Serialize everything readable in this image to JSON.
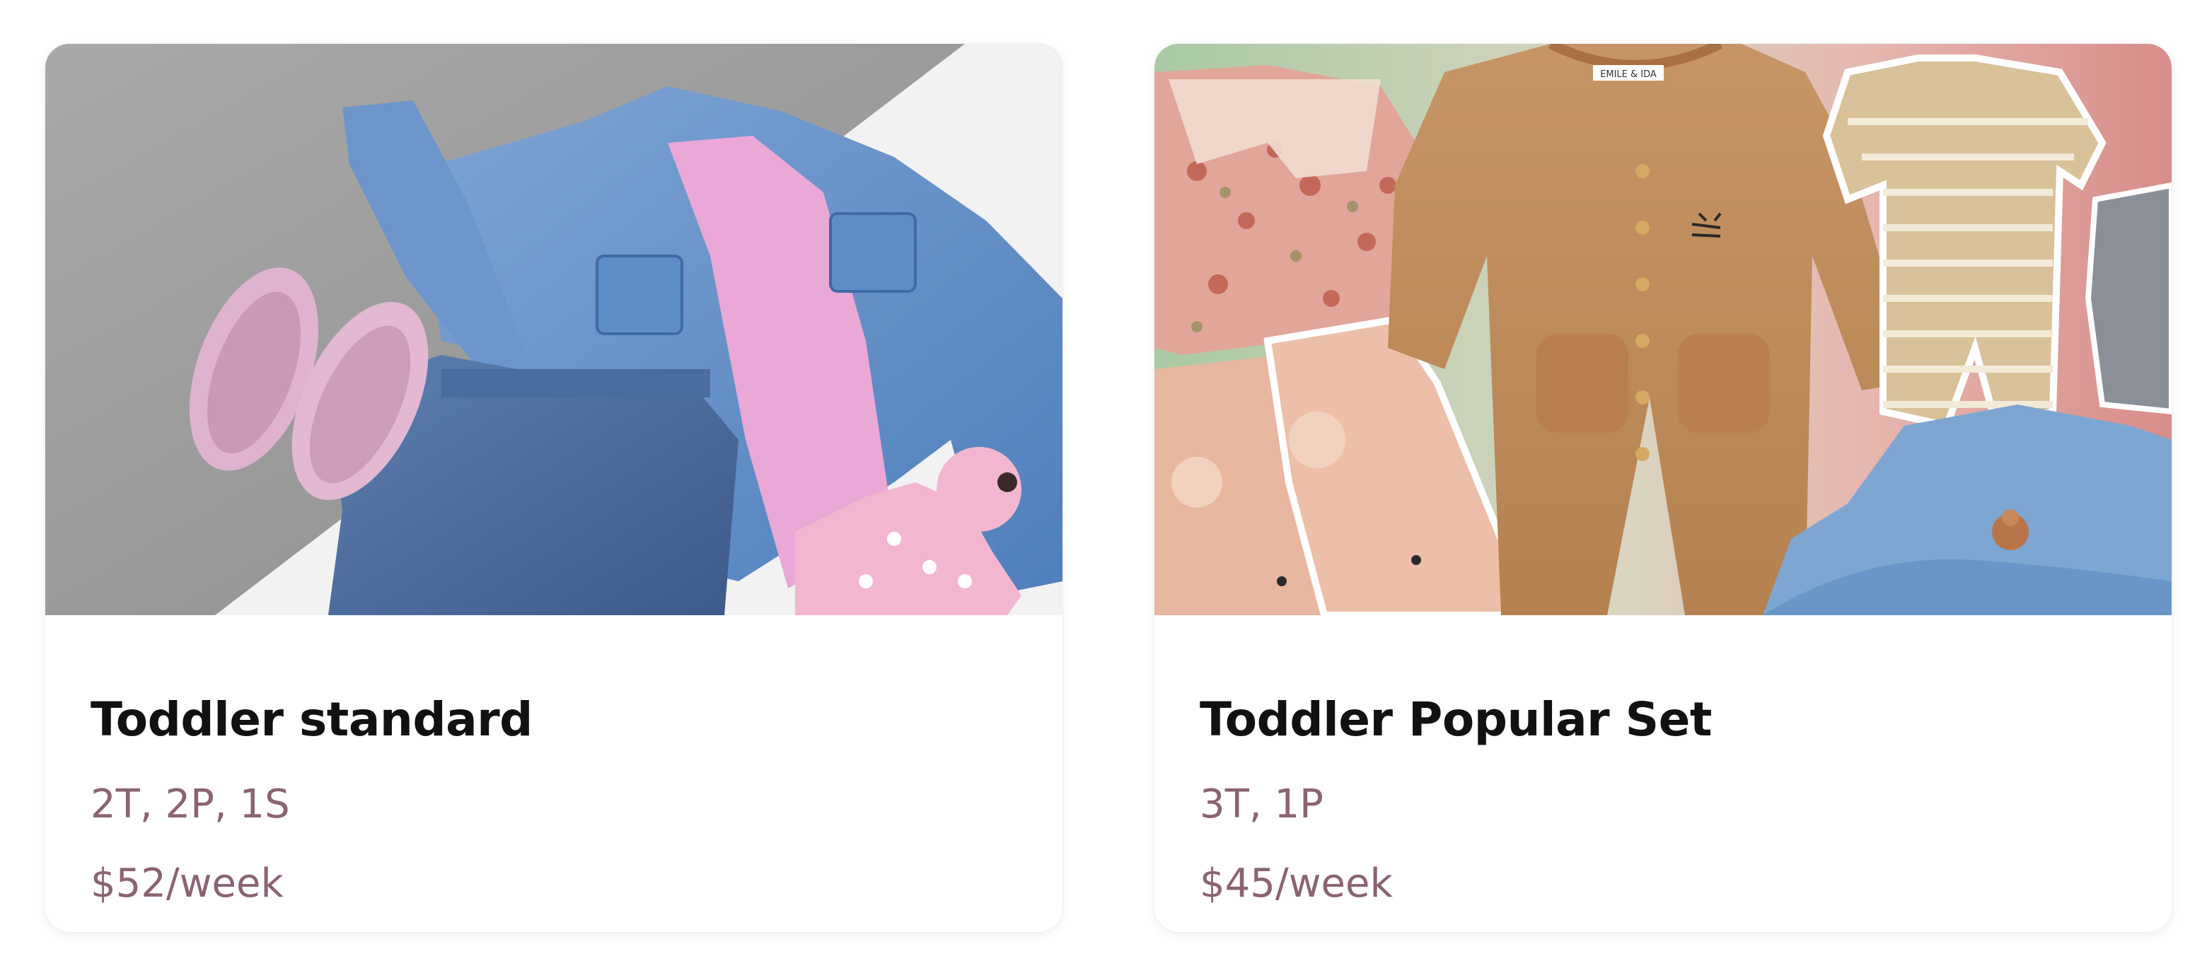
{
  "cards": [
    {
      "title": "Toddler standard",
      "sizes": "2T, 2P, 1S",
      "price": "$52/week",
      "image": "toddler-standard-outfit-photo"
    },
    {
      "title": "Toddler Popular Set",
      "sizes": "3T, 1P",
      "price": "$45/week",
      "image": "toddler-popular-set-collage",
      "label_text": "EMILE & IDA"
    }
  ],
  "colors": {
    "title": "#111111",
    "meta": "#8a6470",
    "card_background": "#ffffff"
  }
}
